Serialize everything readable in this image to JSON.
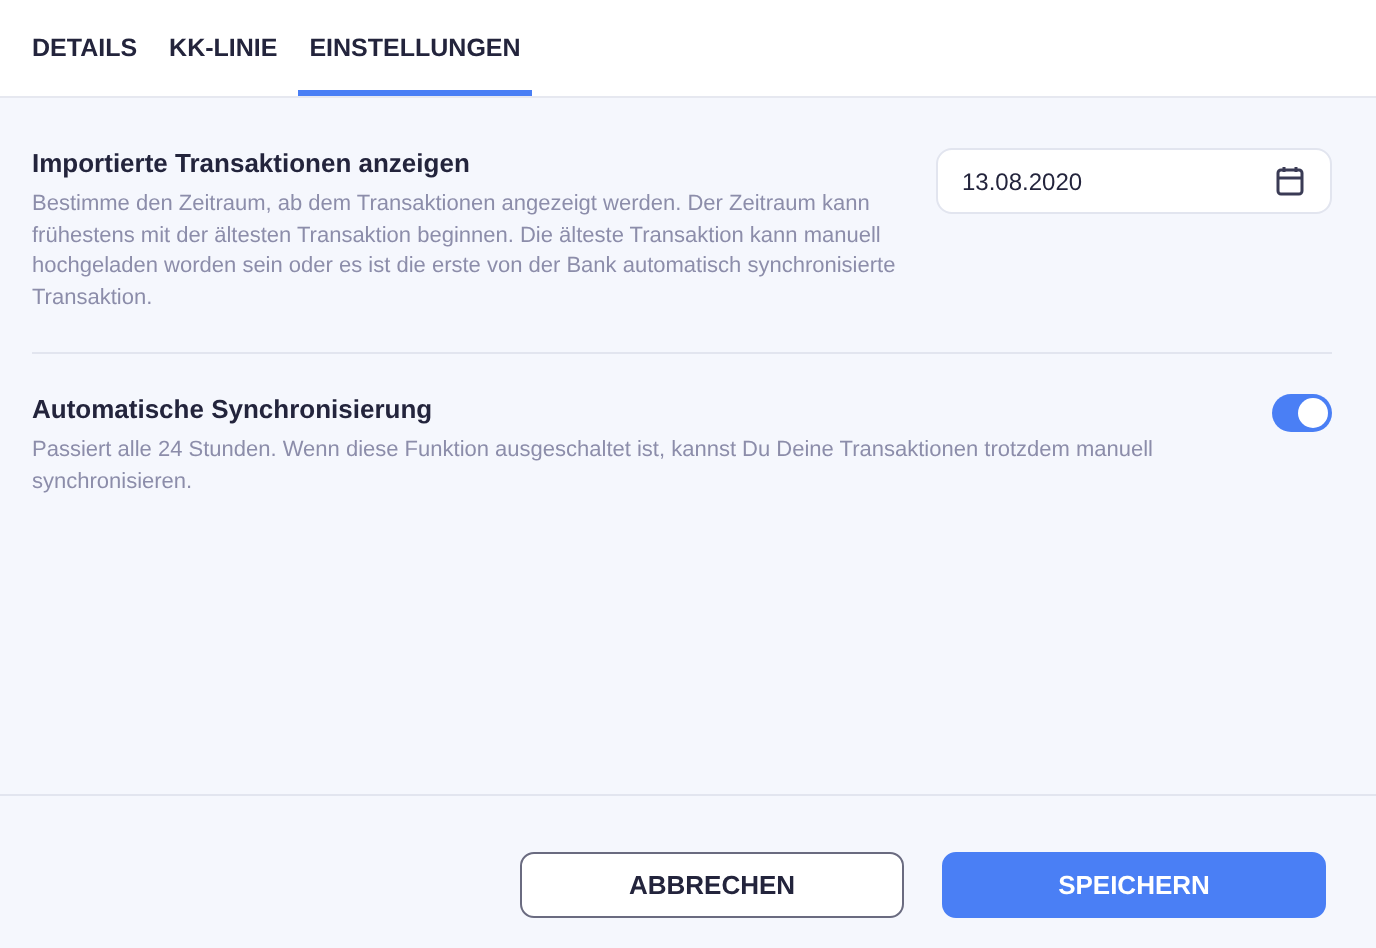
{
  "tabs": [
    {
      "label": "DETAILS",
      "selected": false
    },
    {
      "label": "KK-LINIE",
      "selected": false
    },
    {
      "label": "EINSTELLUNGEN",
      "selected": true
    }
  ],
  "settings": [
    {
      "kind": "date",
      "title": "Importierte Transaktionen anzeigen",
      "description": "Bestimme den Zeitraum, ab dem Transaktionen angezeigt werden. Der Zeitraum kann frühestens mit der ältesten Transaktion beginnen. Die älteste Transaktion kann manuell hochgeladen worden sein oder es ist die erste von der Bank automatisch synchronisierte Transaktion.",
      "value": "13.08.2020"
    },
    {
      "kind": "toggle",
      "title": "Automatische Synchronisierung",
      "description": "Passiert alle 24 Stunden. Wenn diese Funktion ausgeschaltet ist, kannst Du Deine Transaktionen trotzdem manuell synchronisieren.",
      "on": true
    }
  ],
  "buttons": {
    "cancel": "ABBRECHEN",
    "save": "SPEICHERN"
  }
}
